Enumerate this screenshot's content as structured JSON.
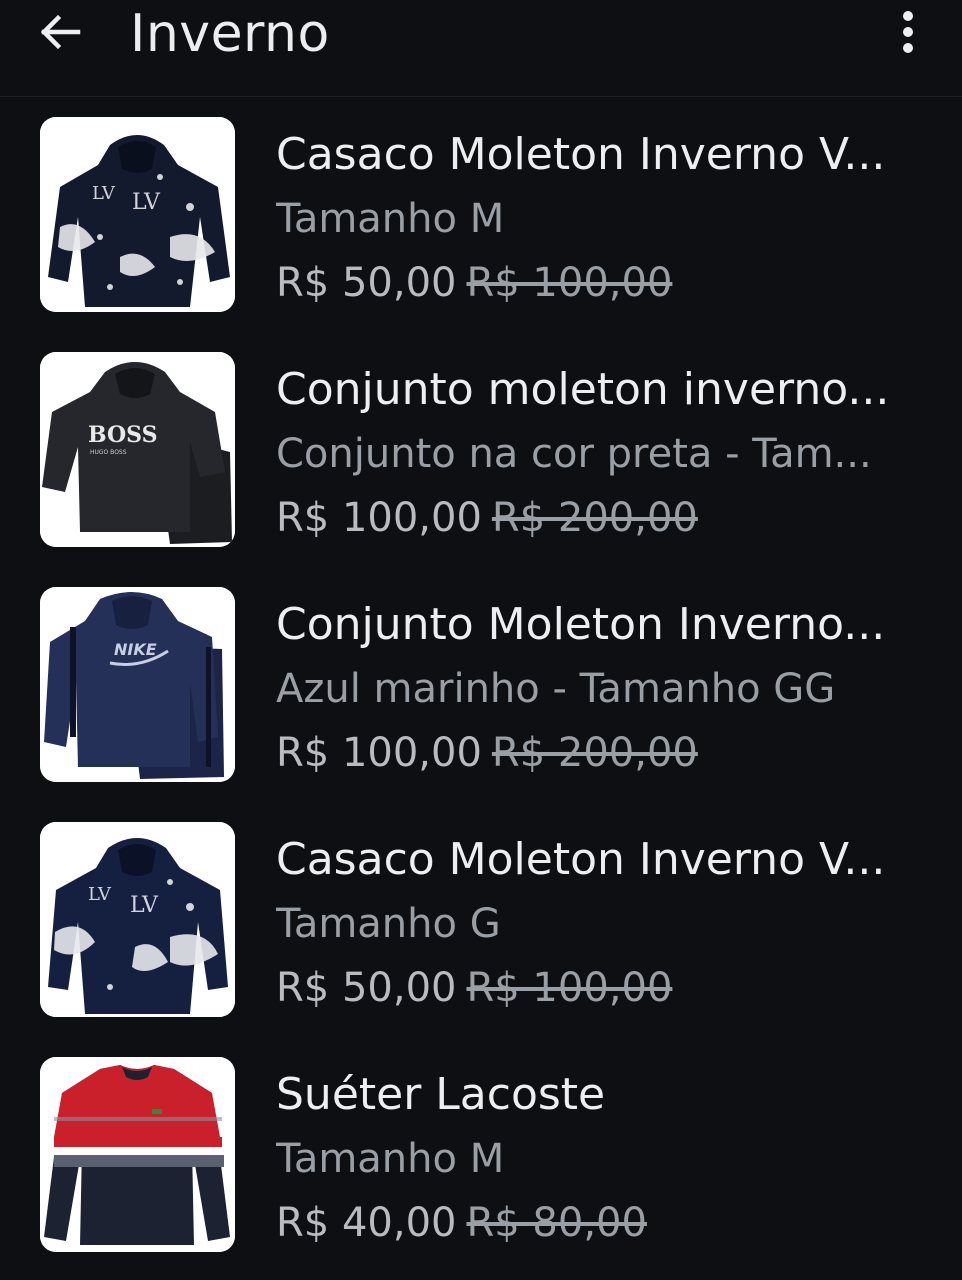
{
  "header": {
    "title": "Inverno",
    "back_icon": "arrow-left-icon",
    "menu_icon": "more-vertical-icon"
  },
  "items": [
    {
      "name": "Casaco Moleton Inverno V...",
      "description": "Tamanho M",
      "price": "R$ 50,00",
      "old_price": "R$ 100,00",
      "image": "hoodie-print-image"
    },
    {
      "name": "Conjunto moleton inverno...",
      "description": "Conjunto na cor preta - Tam...",
      "price": "R$ 100,00",
      "old_price": "R$ 200,00",
      "image": "boss-tracksuit-image"
    },
    {
      "name": "Conjunto Moleton Inverno...",
      "description": "Azul marinho - Tamanho GG",
      "price": "R$ 100,00",
      "old_price": "R$ 200,00",
      "image": "nike-tracksuit-image"
    },
    {
      "name": "Casaco Moleton Inverno V...",
      "description": "Tamanho G",
      "price": "R$ 50,00",
      "old_price": "R$ 100,00",
      "image": "hoodie-print-image"
    },
    {
      "name": "Suéter Lacoste",
      "description": "Tamanho M",
      "price": "R$ 40,00",
      "old_price": "R$ 80,00",
      "image": "striped-sweater-image"
    }
  ],
  "colors": {
    "background": "#0d0f12",
    "text_primary": "#eceef0",
    "text_secondary": "#9a9fa6"
  }
}
